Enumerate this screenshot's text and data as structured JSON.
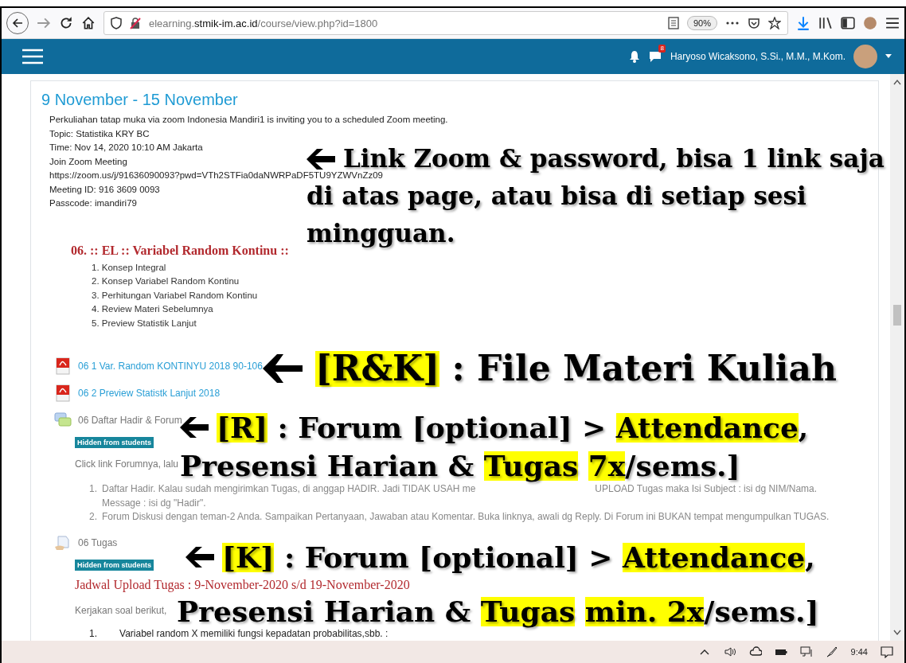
{
  "browser": {
    "url_host": "elearning.",
    "url_domain": "stmik-im.ac.id",
    "url_path": "/course/view.php?id=1800",
    "zoom": "90%"
  },
  "header": {
    "message_count": "8",
    "user_name": "Haryoso Wicaksono, S.Si., M.M., M.Kom."
  },
  "section": {
    "title": "9 November - 15 November",
    "meeting_info": [
      "Perkuliahan tatap muka via zoom Indonesia Mandiri1 is inviting you to a scheduled Zoom meeting.",
      "Topic: Statistika KRY BC",
      "Time: Nov 14, 2020 10:10 AM Jakarta",
      "Join Zoom Meeting",
      "https://zoom.us/j/91636090093?pwd=VTh2STFia0daNWRPaDF5TU9YZWVnZz09",
      "Meeting ID: 916 3609 0093",
      "Passcode: imandiri79"
    ],
    "topic_title": "06. :: EL :: Variabel Random Kontinu ::",
    "topics": [
      "1. Konsep Integral",
      "2. Konsep Variabel Random Kontinu",
      "3. Perhitungan Variabel Random Kontinu",
      "4. Review Materi Sebelumnya",
      "5. Preview Statistik Lanjut"
    ],
    "activities": [
      {
        "kind": "pdf",
        "title": "06 1 Var. Random KONTINYU 2018 90-106",
        "hidden": false
      },
      {
        "kind": "pdf",
        "title": "06 2 Preview Statistk Lanjut 2018",
        "hidden": false
      },
      {
        "kind": "forum",
        "title": "06 Daftar Hadir & Forum",
        "hidden": true,
        "badge": "Hidden from students",
        "intro": "Click link Forumnya, lalu",
        "items": [
          {
            "number": "1.",
            "parts": [
              "Daftar Hadir. Kalau sudah mengirimkan Tugas, di anggap HADIR. Jadi TIDAK USAH me",
              "UPLOAD Tugas maka Isi Subject : isi dg NIM/Nama."
            ],
            "continuation": "Message : isi dg \"Hadir\"."
          },
          {
            "number": "2.",
            "parts": [
              "Forum Diskusi dengan teman-2 Anda. Sampaikan Pertanyaan, Jawaban atau Komentar. Buka linknya, awali dg Reply. Di Forum ini BUKAN tempat mengumpulkan TUGAS."
            ]
          }
        ]
      },
      {
        "kind": "assignment",
        "title": "06 Tugas",
        "hidden": true,
        "badge": "Hidden from students",
        "schedule": "Jadwal Upload Tugas : 9-November-2020 s/d 19-November-2020",
        "intro": "Kerjakan soal berikut,",
        "items": [
          {
            "number": "1.",
            "parts": [
              "Variabel random X memiliki fungsi kepadatan probabilitas,sbb. :"
            ]
          }
        ]
      }
    ]
  },
  "annotations": [
    {
      "lines": [
        [
          {
            "text": "Link Zoom & password, bisa 1 link saja",
            "highlight": false
          }
        ],
        [
          {
            "text": "di atas page, atau bisa di setiap sesi",
            "highlight": false
          }
        ],
        [
          {
            "text": "mingguan.",
            "highlight": false
          }
        ]
      ]
    },
    {
      "lines": [
        [
          {
            "text": "[R&K]",
            "highlight": true
          },
          {
            "text": ": File Materi Kuliah",
            "highlight": false,
            "space_before": true
          }
        ]
      ]
    },
    {
      "lines": [
        [
          {
            "text": "[R]",
            "highlight": true
          },
          {
            "text": ": Forum [optional] >",
            "highlight": false,
            "space_before": true
          },
          {
            "text": "Attendance",
            "highlight": true,
            "space_before": true
          },
          {
            "text": ",",
            "highlight": false
          }
        ],
        [
          {
            "text": "Presensi Harian &",
            "highlight": false
          },
          {
            "text": "Tugas",
            "highlight": true,
            "space_before": true
          },
          {
            "text": "7x",
            "highlight": true,
            "space_before": true
          },
          {
            "text": "/sems.]",
            "highlight": false
          }
        ]
      ]
    },
    {
      "lines": [
        [
          {
            "text": "[K]",
            "highlight": true
          },
          {
            "text": ": Forum [optional] >",
            "highlight": false,
            "space_before": true
          },
          {
            "text": "Attendance",
            "highlight": true,
            "space_before": true
          },
          {
            "text": ",",
            "highlight": false
          }
        ],
        [
          {
            "text": "Presensi Harian &",
            "highlight": false
          },
          {
            "text": "Tugas",
            "highlight": true,
            "space_before": true
          },
          {
            "text": "min. 2x",
            "highlight": true,
            "space_before": true
          },
          {
            "text": "/sems.]",
            "highlight": false
          }
        ]
      ]
    }
  ],
  "taskbar": {
    "time": "9:44"
  }
}
